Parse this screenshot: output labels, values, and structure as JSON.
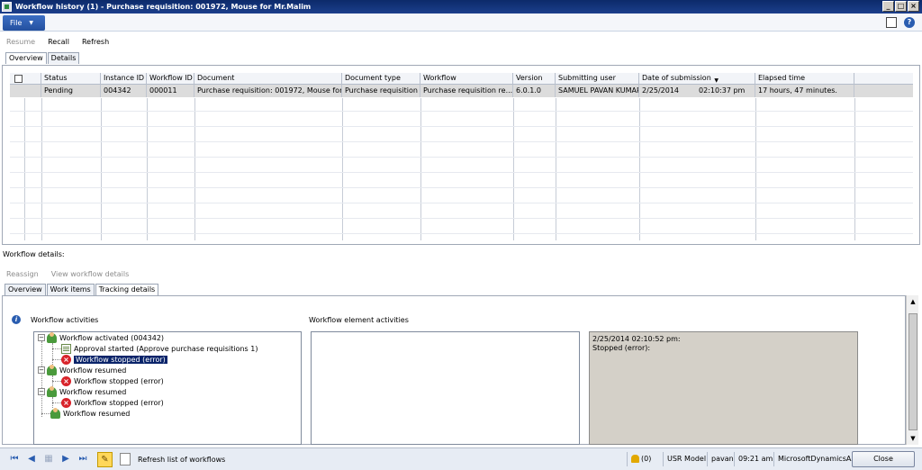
{
  "window": {
    "title": "Workflow history (1) - Purchase requisition: 001972, Mouse for Mr.Malim",
    "buttons": [
      "_",
      "□",
      "×"
    ]
  },
  "menu": {
    "file_label": "File",
    "layout_icon": "layout-icon",
    "help_icon": "?"
  },
  "actions": [
    {
      "label": "Resume",
      "enabled": false
    },
    {
      "label": "Recall",
      "enabled": true
    },
    {
      "label": "Refresh",
      "enabled": true
    }
  ],
  "top_tabs": [
    {
      "label": "Overview",
      "active": true
    },
    {
      "label": "Details",
      "active": false
    }
  ],
  "grid": {
    "columns": [
      "Status",
      "Instance ID",
      "Workflow ID",
      "Document",
      "Document type",
      "Workflow",
      "Version",
      "Submitting user",
      "Date of submission",
      "Elapsed time"
    ],
    "rows": [
      [
        "Pending",
        "004342",
        "000011",
        "Purchase requisition: 001972, Mouse for...",
        "Purchase requisition",
        "Purchase requisition re...",
        "6.0.1.0",
        "SAMUEL PAVAN KUMAR",
        "2/25/2014",
        "02:10:37 pm",
        "17 hours, 47 minutes."
      ]
    ]
  },
  "details": {
    "label": "Workflow details:",
    "actions": [
      {
        "label": "Reassign",
        "enabled": false
      },
      {
        "label": "View workflow details",
        "enabled": false
      }
    ],
    "tabs": [
      {
        "label": "Overview",
        "active": false
      },
      {
        "label": "Work items",
        "active": false
      },
      {
        "label": "Tracking details",
        "active": true
      }
    ]
  },
  "tracking": {
    "activities_label": "Workflow activities",
    "element_activities_label": "Workflow element activities",
    "tree": [
      {
        "label": "Workflow activated (004342)",
        "icon": "person-icon",
        "expander": "−"
      },
      {
        "label": "Approval started (Approve purchase requisitions 1)",
        "icon": "document-icon"
      },
      {
        "label": "Workflow stopped (error)",
        "icon": "error-icon",
        "selected": true
      },
      {
        "label": "Workflow resumed",
        "icon": "person-icon",
        "expander": "−"
      },
      {
        "label": "Workflow stopped (error)",
        "icon": "error-icon"
      },
      {
        "label": "Workflow resumed",
        "icon": "person-icon",
        "expander": "−"
      },
      {
        "label": "Workflow stopped (error)",
        "icon": "error-icon"
      },
      {
        "label": "Workflow resumed",
        "icon": "person-icon"
      }
    ],
    "message_line1": "2/25/2014 02:10:52 pm:",
    "message_line2": "Stopped (error):"
  },
  "status": {
    "text": "Refresh list of workflows",
    "alerts": "(0)",
    "model": "USR Model",
    "user": "pavan",
    "time": "09:21 am",
    "company": "MicrosoftDynamicsAX",
    "close_label": "Close"
  }
}
